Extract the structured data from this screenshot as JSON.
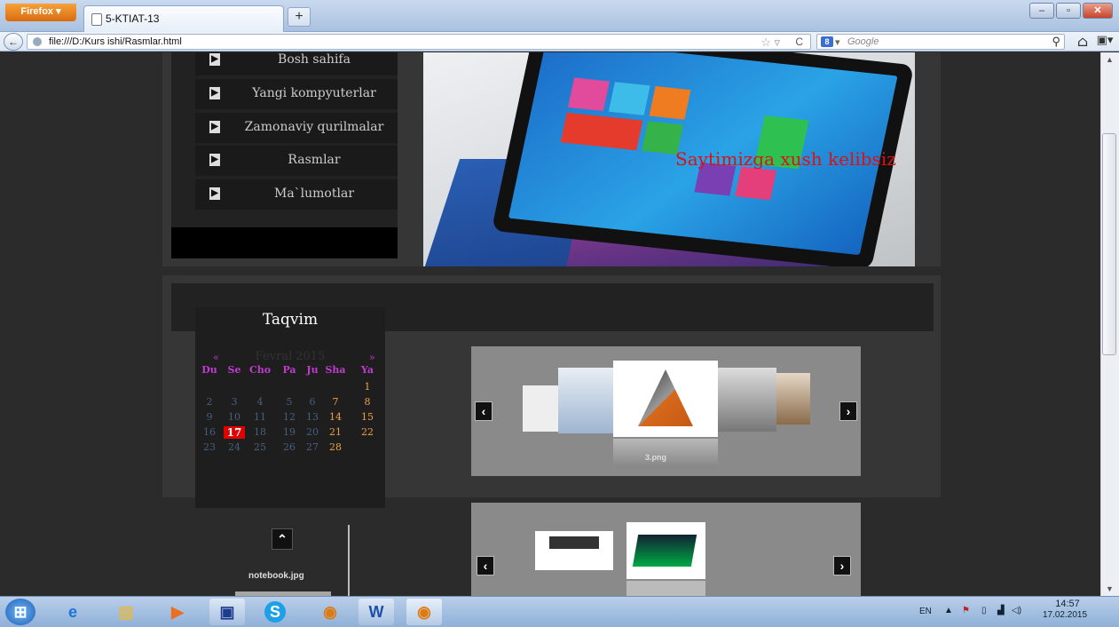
{
  "browser": {
    "firefox_button": "Firefox",
    "tab_title": "5-KTIAT-13",
    "new_tab": "+",
    "url": "file:///D:/Kurs ishi/Rasmlar.html",
    "search_placeholder": "Google",
    "search_engine_icon": "google-icon",
    "window_buttons": [
      "–",
      "▫",
      "✕"
    ]
  },
  "page": {
    "nav_items": [
      "Bosh sahifa",
      "Yangi kompyuterlar",
      "Zamonaviy qurilmalar",
      "Rasmlar",
      "Ma`lumotlar"
    ],
    "nav_icon": "arrow-right-icon",
    "hero_text": "Saytimizga xush kelibsiz",
    "hero_text_color": "#e01010",
    "calendar": {
      "title": "Taqvim",
      "prev": "«",
      "next": "»",
      "month": "Fevral 2015",
      "weekdays": [
        "Du",
        "Se",
        "Cho",
        "Pa",
        "Ju",
        "Sha",
        "Ya"
      ],
      "weeks": [
        [
          "",
          "",
          "",
          "",
          "",
          "",
          "1"
        ],
        [
          "2",
          "3",
          "4",
          "5",
          "6",
          "7",
          "8"
        ],
        [
          "9",
          "10",
          "11",
          "12",
          "13",
          "14",
          "15"
        ],
        [
          "16",
          "17",
          "18",
          "19",
          "20",
          "21",
          "22"
        ],
        [
          "23",
          "24",
          "25",
          "26",
          "27",
          "28",
          ""
        ]
      ],
      "today": "17",
      "today_color": "#e00000",
      "weekday_color": "#c23bd0",
      "weekend_color": "#f0a040"
    },
    "gallery1": {
      "caption": "3.png",
      "prev": "‹",
      "next": "›"
    },
    "gallery2": {
      "prev": "‹",
      "next": "›"
    },
    "scroll_top_icon": "chevron-up-icon",
    "thumb_caption": "notebook.jpg"
  },
  "taskbar": {
    "language": "EN",
    "time": "14:57",
    "date": "17.02.2015",
    "apps": [
      "start-orb-icon",
      "ie-icon",
      "explorer-icon",
      "media-player-icon",
      "save-icon",
      "skype-icon",
      "firefox-icon",
      "word-icon",
      "firefox-icon"
    ]
  }
}
